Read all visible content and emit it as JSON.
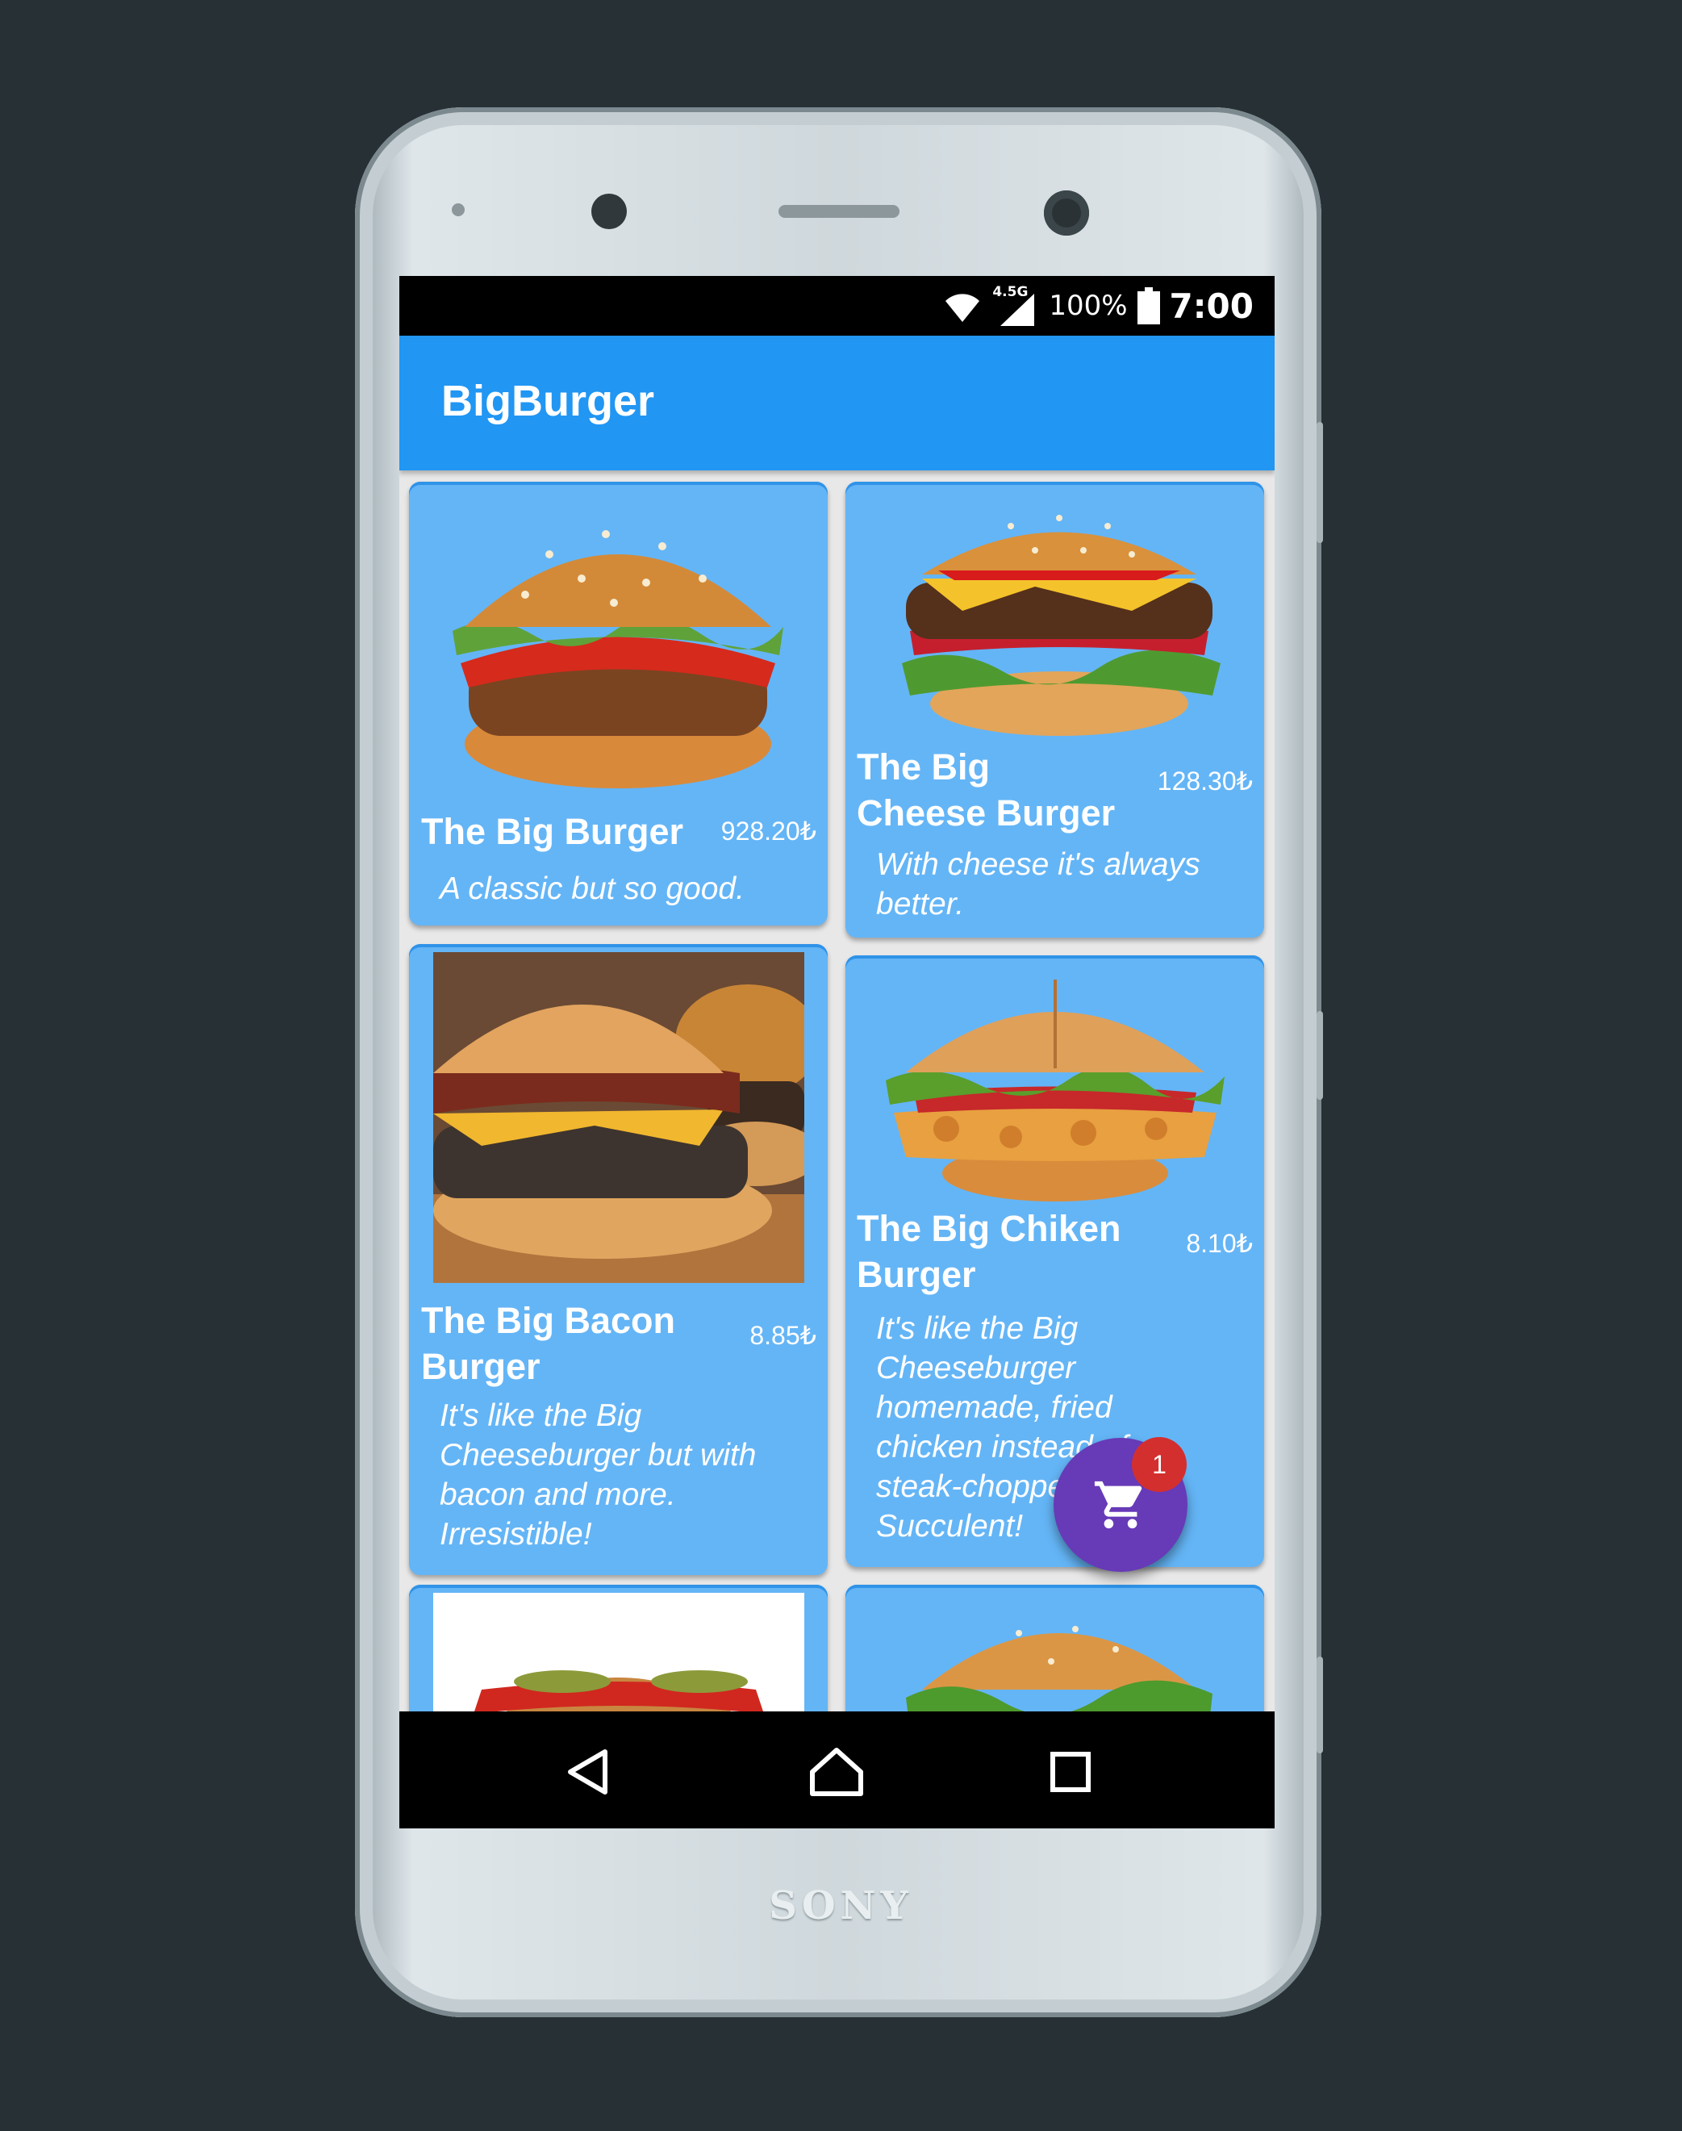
{
  "device": {
    "brand": "SONY"
  },
  "status_bar": {
    "network": "4.5G",
    "battery": "100%",
    "time": "7:00",
    "icons": [
      "wifi-icon",
      "signal-icon",
      "battery-icon"
    ]
  },
  "app_bar": {
    "title": "BigBurger",
    "color": "#2196f3"
  },
  "products": [
    {
      "name": "The Big Burger",
      "price": "928.20₺",
      "description": "A classic but so good."
    },
    {
      "name": "The Big Cheese Burger",
      "price": "128.30₺",
      "description": "With cheese it's always better."
    },
    {
      "name": "The Big Bacon Burger",
      "price": "8.85₺",
      "description": "It's like the Big Cheeseburger but with bacon and more. Irresistible!"
    },
    {
      "name": "The Big Chiken Burger",
      "price": "8.10₺",
      "description": "It's like the Big Cheeseburger homemade, fried chicken instead of steak-chopped. Succulent!"
    }
  ],
  "cart": {
    "count": "1",
    "icon": "cart-icon",
    "fab_color": "#673ab7",
    "badge_color": "#d32f2f"
  },
  "nav_bar": {
    "icons": [
      "back-icon",
      "home-icon",
      "recents-icon"
    ]
  },
  "colors": {
    "card": "#64b5f6",
    "background": "#263035"
  }
}
